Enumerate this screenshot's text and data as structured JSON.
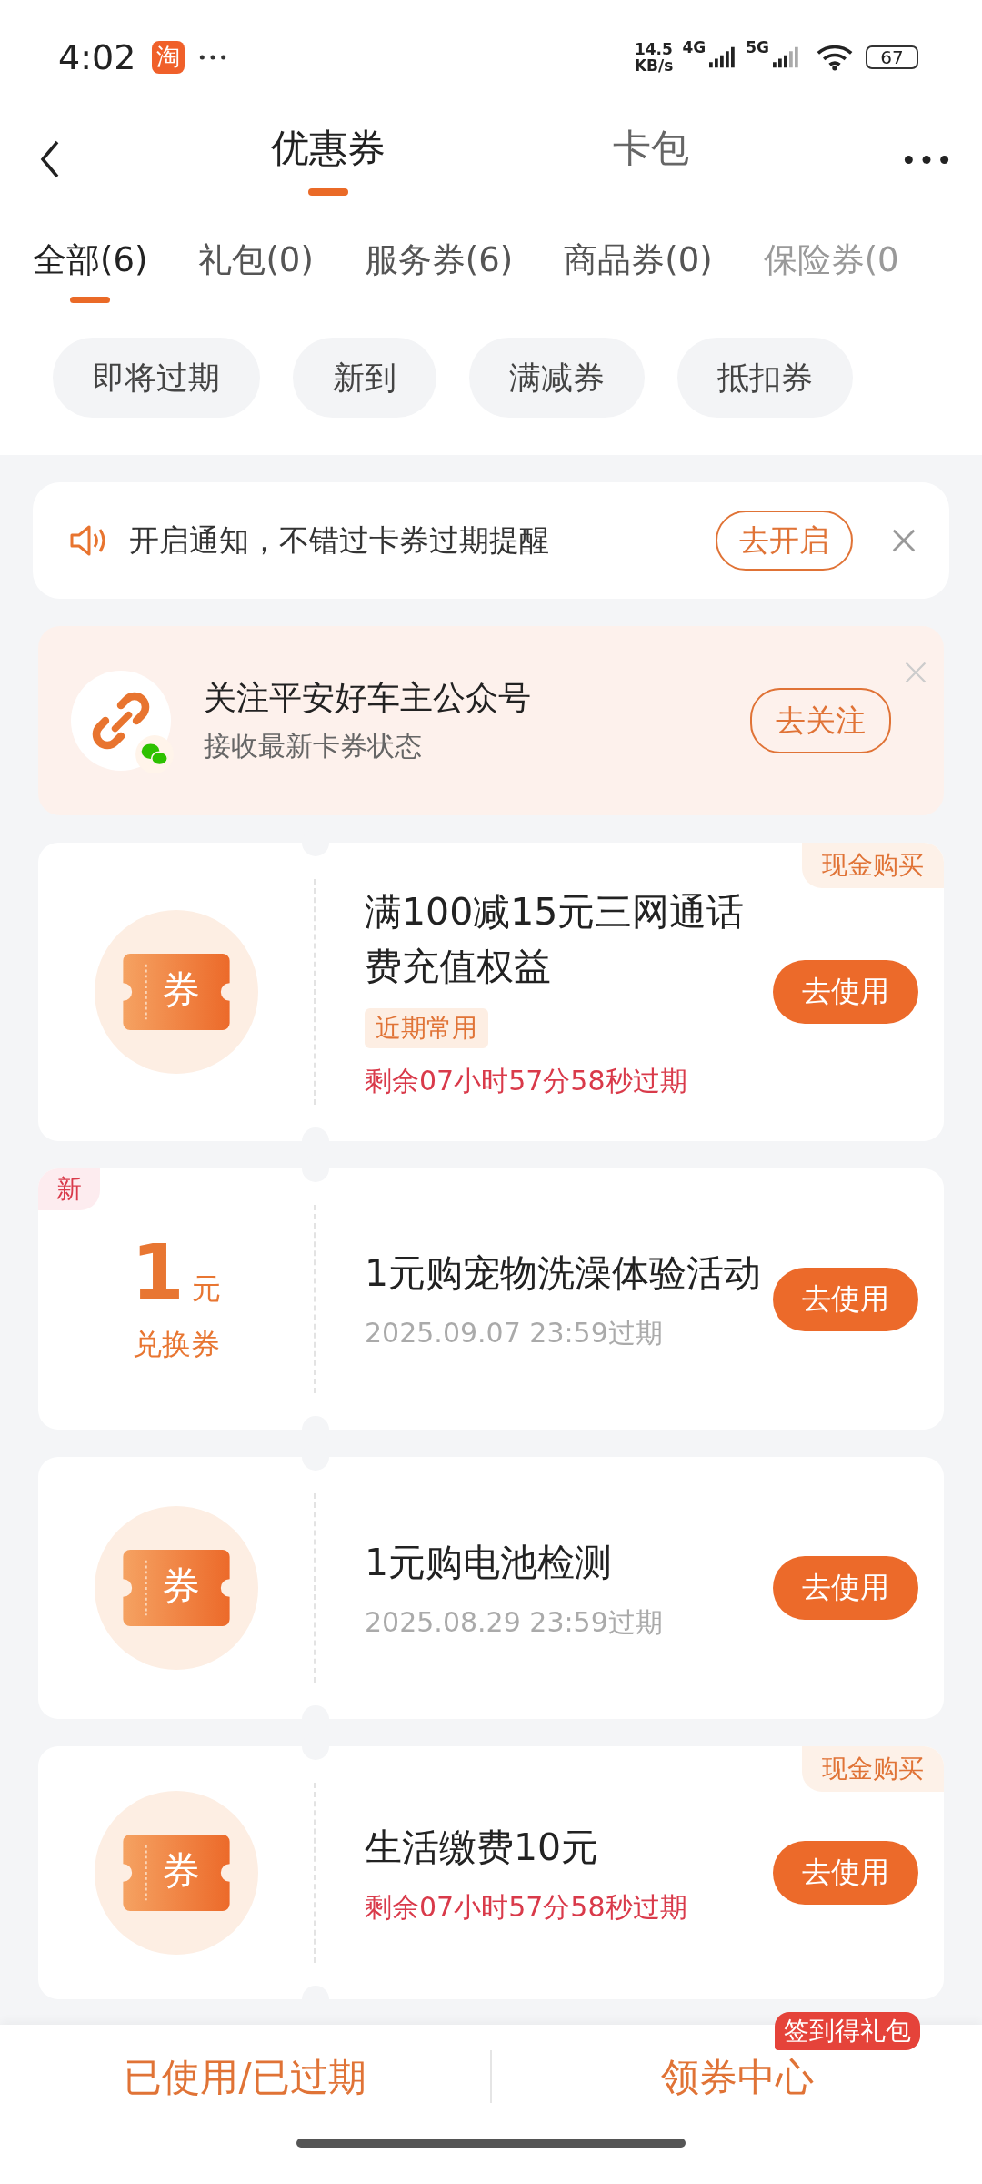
{
  "status_bar": {
    "time": "4:02",
    "app_badge": "淘",
    "net_speed": [
      "14.5",
      "KB/s"
    ],
    "network_1": "4G",
    "network_2": "5G",
    "battery": "67"
  },
  "header": {
    "tabs": [
      {
        "label": "优惠券",
        "selected": true
      },
      {
        "label": "卡包",
        "selected": false
      }
    ]
  },
  "categories": [
    {
      "label": "全部(6)",
      "selected": true
    },
    {
      "label": "礼包(0)",
      "selected": false
    },
    {
      "label": "服务券(6)",
      "selected": false
    },
    {
      "label": "商品券(0)",
      "selected": false
    },
    {
      "label": "保险券(0",
      "selected": false
    }
  ],
  "filters": [
    "即将过期",
    "新到",
    "满减券",
    "抵扣券"
  ],
  "notice": {
    "text": "开启通知，不错过卡券过期提醒",
    "button": "去开启"
  },
  "follow": {
    "title": "关注平安好车主公众号",
    "subtitle": "接收最新卡券状态",
    "button": "去关注"
  },
  "coupons": [
    {
      "kind": "icon",
      "icon_text": "券",
      "title_lines": [
        "满100减15元三网通话",
        "费充值权益"
      ],
      "badge": "近期常用",
      "expiry": "剩余07小时57分58秒过期",
      "urgent": true,
      "corner_tag": "现金购买",
      "button": "去使用"
    },
    {
      "kind": "amount",
      "amount": "1",
      "unit": "元",
      "type_label": "兑换券",
      "new_tag": "新",
      "title_lines": [
        "1元购宠物洗澡体验活动"
      ],
      "expiry": "2025.09.07 23:59过期",
      "urgent": false,
      "button": "去使用"
    },
    {
      "kind": "icon",
      "icon_text": "券",
      "title_lines": [
        "1元购电池检测"
      ],
      "expiry": "2025.08.29 23:59过期",
      "urgent": false,
      "button": "去使用"
    },
    {
      "kind": "icon",
      "icon_text": "券",
      "title_lines": [
        "生活缴费10元"
      ],
      "expiry": "剩余07小时57分58秒过期",
      "urgent": true,
      "corner_tag": "现金购买",
      "button": "去使用"
    }
  ],
  "bottom_bar": {
    "left": "已使用/已过期",
    "right": "领券中心",
    "right_badge": "签到得礼包"
  }
}
